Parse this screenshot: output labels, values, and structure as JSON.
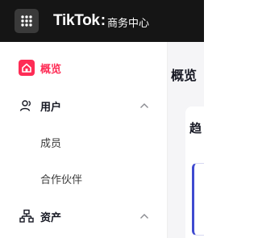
{
  "header": {
    "brand": "TikTok",
    "brand_separator": ":",
    "product": "商务中心"
  },
  "sidebar": {
    "items": [
      {
        "label": "概览",
        "icon": "home-icon",
        "active": true
      },
      {
        "label": "用户",
        "icon": "users-icon",
        "expanded": true,
        "children": [
          {
            "label": "成员"
          },
          {
            "label": "合作伙伴"
          }
        ]
      },
      {
        "label": "资产",
        "icon": "assets-icon",
        "expanded": true
      }
    ]
  },
  "main": {
    "title": "概览",
    "section_title": "趋"
  },
  "colors": {
    "topbar": "#151515",
    "accent": "#fe2c55",
    "card_border": "#3f4ad0"
  }
}
